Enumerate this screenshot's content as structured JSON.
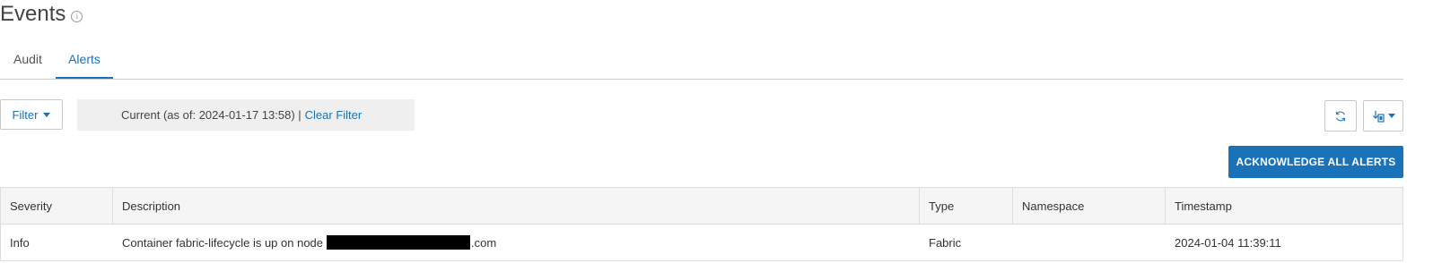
{
  "page": {
    "title": "Events",
    "info_icon": "info-icon"
  },
  "tabs": [
    {
      "label": "Audit",
      "active": false
    },
    {
      "label": "Alerts",
      "active": true
    }
  ],
  "filter": {
    "button_label": "Filter",
    "status_text": "Current (as of: 2024-01-17 13:58) |",
    "clear_label": "Clear Filter"
  },
  "toolbar": {
    "refresh_icon": "refresh-icon",
    "export_icon": "export-icon",
    "acknowledge_label": "ACKNOWLEDGE ALL ALERTS"
  },
  "colors": {
    "accent": "#1a73b8",
    "header_bg": "#f5f5f5",
    "filter_bg": "#efefef"
  },
  "table": {
    "columns": [
      "Severity",
      "Description",
      "Type",
      "Namespace",
      "Timestamp"
    ],
    "rows": [
      {
        "severity": "Info",
        "description_prefix": "Container fabric-lifecycle is up on node",
        "description_suffix": ".com",
        "type": "Fabric",
        "namespace": "",
        "timestamp": "2024-01-04 11:39:11"
      }
    ]
  }
}
